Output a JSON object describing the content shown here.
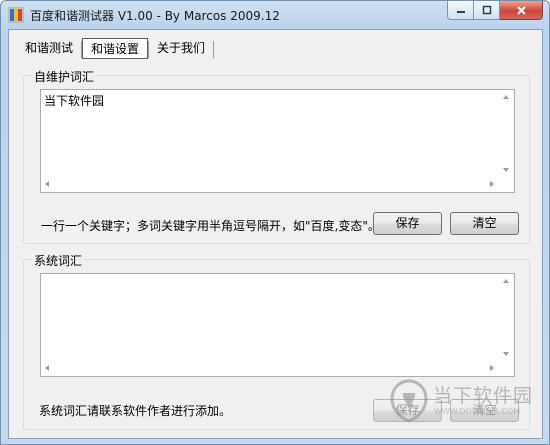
{
  "window": {
    "title": "百度和谐测试器 V1.00 - By Marcos 2009.12"
  },
  "tabs": [
    {
      "label": "和谐测试",
      "active": false
    },
    {
      "label": "和谐设置",
      "active": true
    },
    {
      "label": "关于我们",
      "active": false
    }
  ],
  "custom_group": {
    "title": "自维护词汇",
    "text": "当下软件园",
    "hint": "一行一个关键字；多词关键字用半角逗号隔开，如\"百度,变态\"。",
    "save_label": "保存",
    "clear_label": "清空"
  },
  "system_group": {
    "title": "系统词汇",
    "text": "",
    "hint": "系统词汇请联系软件作者进行添加。",
    "save_label": "保存",
    "clear_label": "清空"
  },
  "watermark": {
    "text": "当下软件园",
    "sub": "WWW.DOWNXIA.COM"
  },
  "colors": {
    "title_bar": "#bcd3ec",
    "client_bg": "#f0f0f0",
    "close_button": "#c9473a"
  }
}
